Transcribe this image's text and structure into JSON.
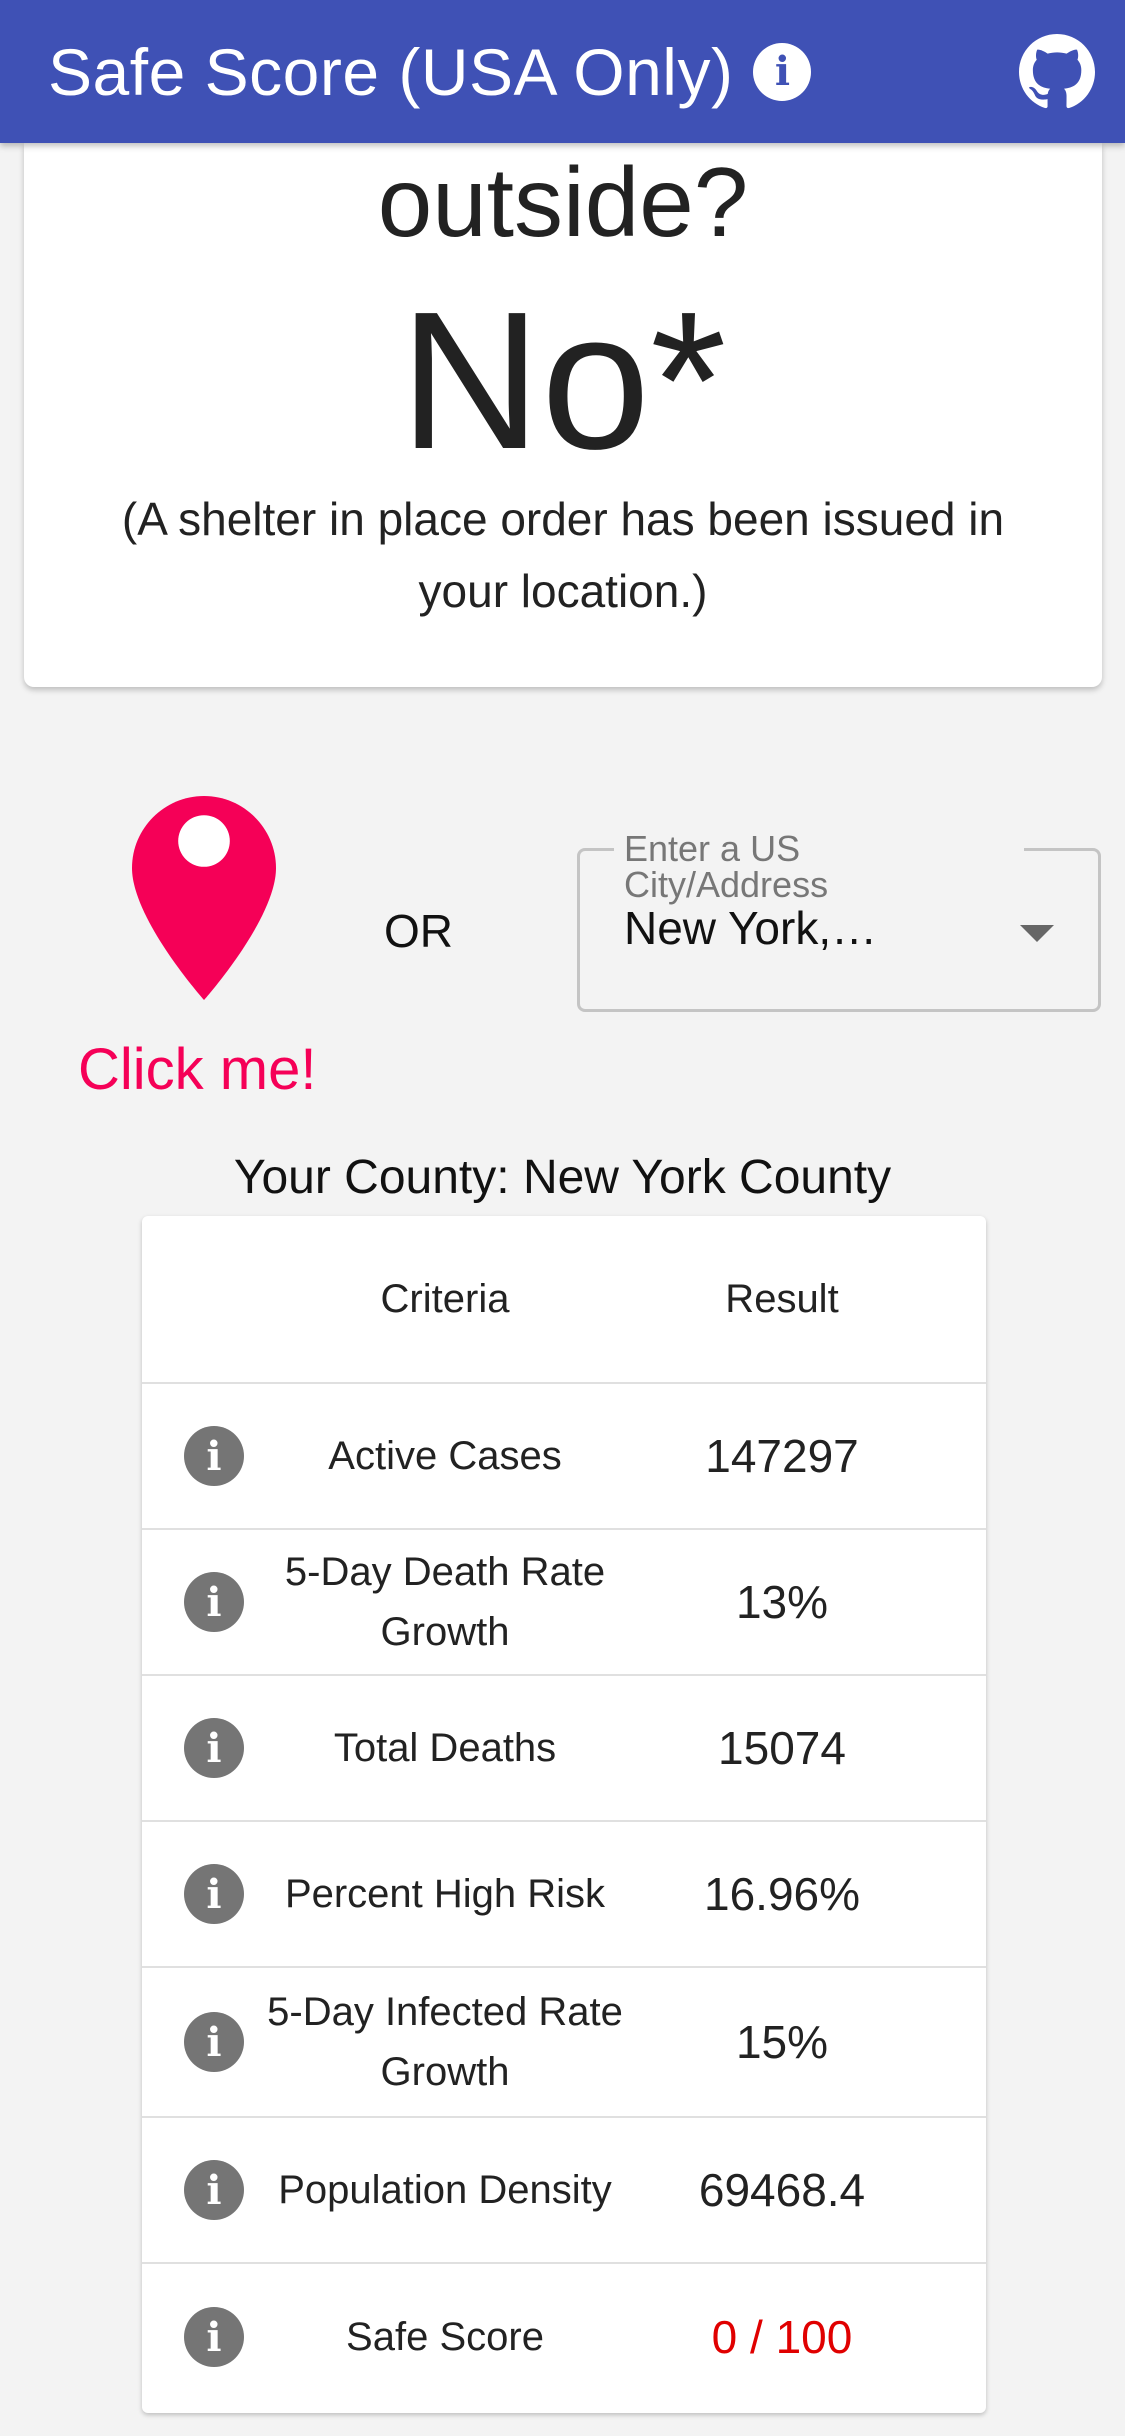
{
  "app": {
    "title": "Safe Score (USA Only)",
    "info_icon": "info-icon",
    "github_icon": "github-icon",
    "bar_color": "#3f51b5"
  },
  "answer": {
    "question_tail": "outside?",
    "result": "No*",
    "note": "(A shelter in place order has been issued in your location.)"
  },
  "location": {
    "pin_icon": "location-pin-icon",
    "pin_color": "#f50057",
    "click_label": "Click me!",
    "or_label": "OR",
    "address_label": "Enter a US City/Address",
    "address_value": "New York,…"
  },
  "county": "Your County: New York County",
  "table": {
    "headers": {
      "criteria": "Criteria",
      "result": "Result"
    },
    "rows": [
      {
        "criteria": "Active Cases",
        "result": "147297"
      },
      {
        "criteria": "5-Day Death Rate Growth",
        "result": "13%"
      },
      {
        "criteria": "Total Deaths",
        "result": "15074"
      },
      {
        "criteria": "Percent High Risk",
        "result": "16.96%"
      },
      {
        "criteria": "5-Day Infected Rate Growth",
        "result": "15%"
      },
      {
        "criteria": "Population Density",
        "result": "69468.4"
      },
      {
        "criteria": "Safe Score",
        "result": "0 / 100",
        "result_color": "#e00000"
      }
    ]
  }
}
